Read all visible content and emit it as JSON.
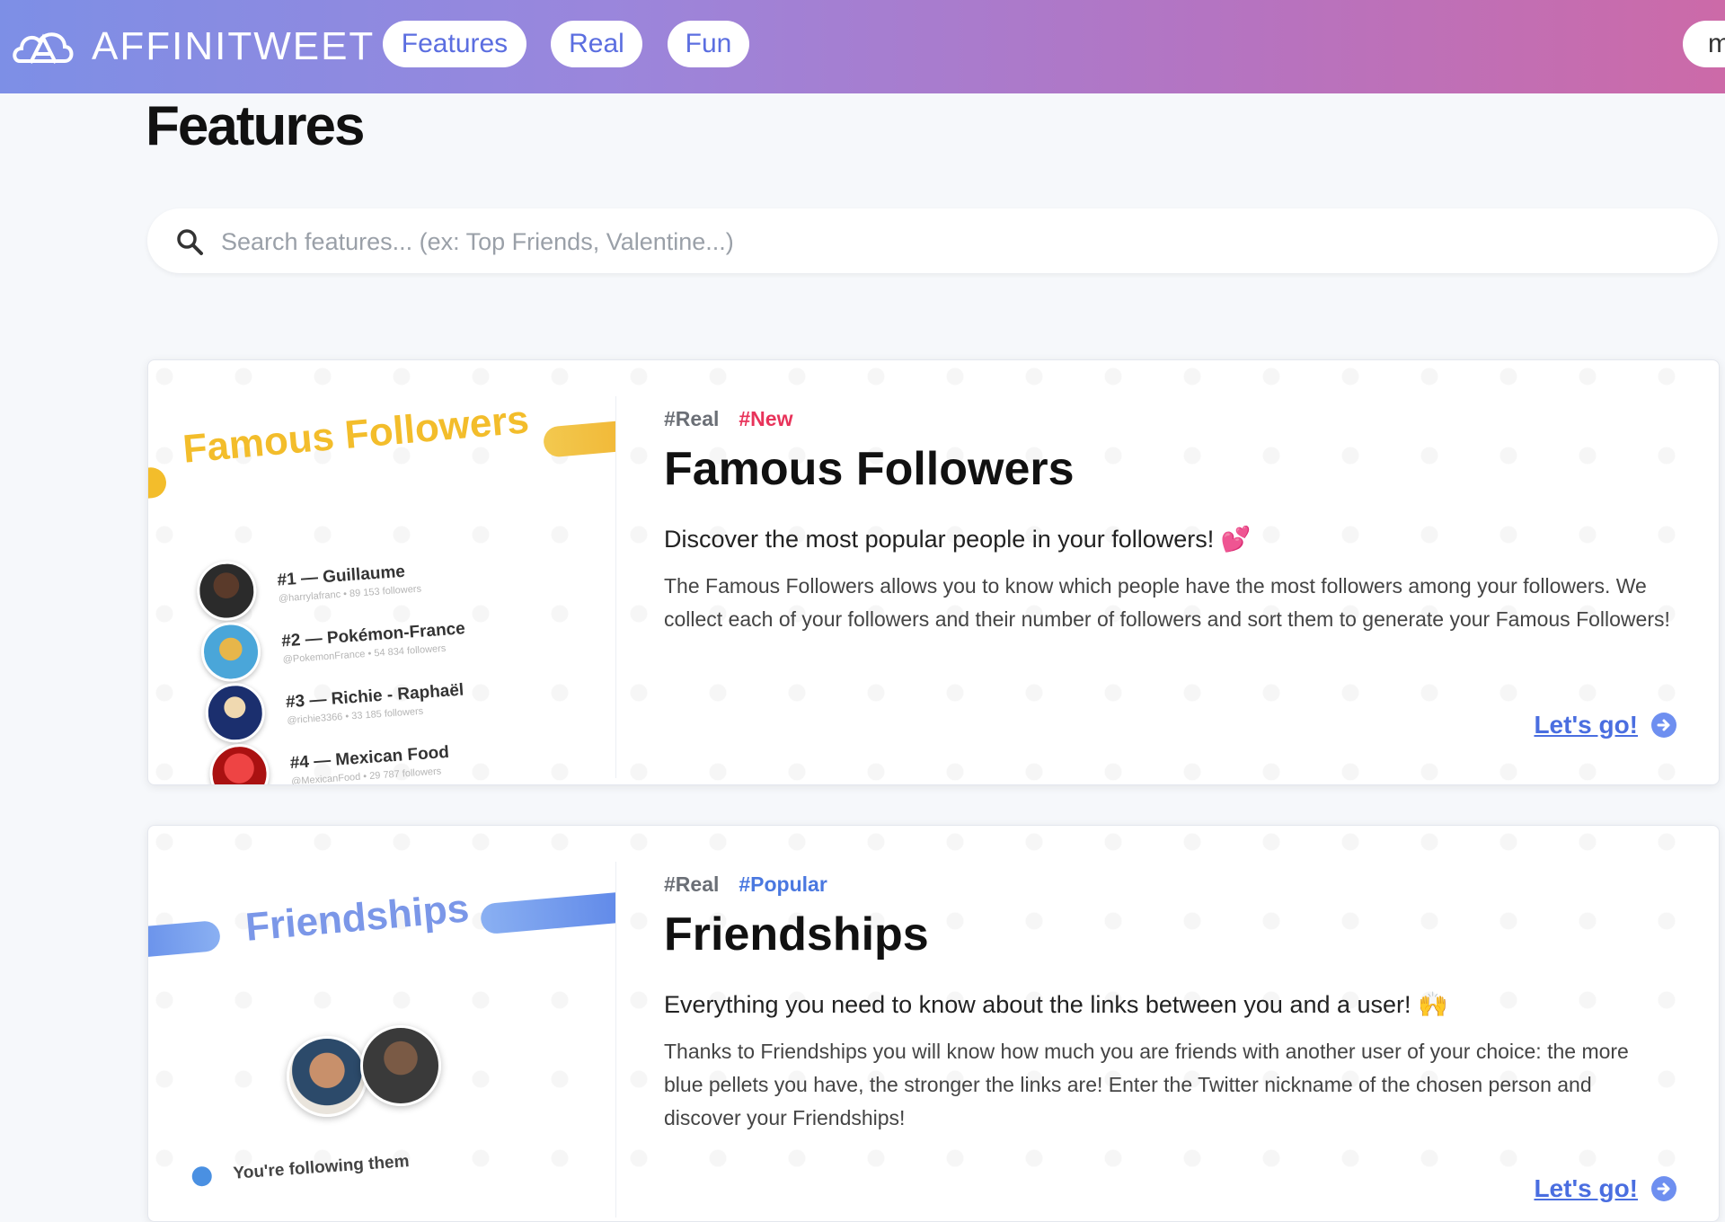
{
  "header": {
    "brand": "AFFINITWEET",
    "nav": [
      {
        "label": "Features"
      },
      {
        "label": "Real"
      },
      {
        "label": "Fun"
      }
    ],
    "extra_partial_label": "m"
  },
  "page": {
    "title": "Features"
  },
  "search": {
    "placeholder": "Search features... (ex: Top Friends, Valentine...)",
    "icon": "search-icon"
  },
  "features": [
    {
      "tags": [
        "#Real",
        "#New"
      ],
      "title": "Famous Followers",
      "subtitle": "Discover the most popular people in your followers! 💕",
      "description": "The Famous Followers allows you to know which people have the most followers among your followers. We collect each of your followers and their number of followers and sort them to generate your Famous Followers!",
      "cta": "Let's go!",
      "thumbnail": {
        "title": "Famous Followers",
        "accent": "#f3bd2b",
        "list": [
          {
            "name": "#1 — Guillaume",
            "meta": "@harrylafranc • 89 153 followers"
          },
          {
            "name": "#2 — Pokémon-France",
            "meta": "@PokemonFrance • 54 834 followers"
          },
          {
            "name": "#3 — Richie - Raphaël",
            "meta": "@richie3366 • 33 185 followers"
          },
          {
            "name": "#4 — Mexican Food",
            "meta": "@MexicanFood • 29 787 followers"
          }
        ]
      }
    },
    {
      "tags": [
        "#Real",
        "#Popular"
      ],
      "title": "Friendships",
      "subtitle": "Everything you need to know about the links between you and a user! 🙌",
      "description": "Thanks to Friendships you will know how much you are friends with another user of your choice: the more blue pellets you have, the stronger the links are! Enter the Twitter nickname of the chosen person and discover your Friendships!",
      "cta": "Let's go!",
      "thumbnail": {
        "title": "Friendships",
        "accent": "#7b97e8",
        "status": "You're following them"
      }
    }
  ],
  "colors": {
    "header_gradient_start": "#7d8fe6",
    "header_gradient_end": "#cc6aa8",
    "link": "#4a6ee0",
    "tag_new": "#e8335a",
    "tag_popular": "#4a78e0"
  }
}
